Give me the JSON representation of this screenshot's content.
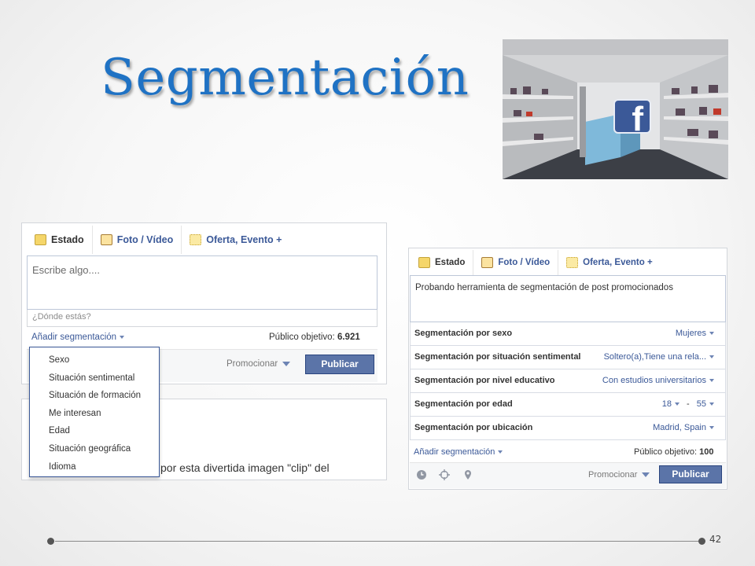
{
  "slide": {
    "title": "Segmentación",
    "page_number": "42"
  },
  "left_composer": {
    "tabs": [
      {
        "label": "Estado",
        "icon": "status-icon"
      },
      {
        "label": "Foto / Vídeo",
        "icon": "photo-icon"
      },
      {
        "label": "Oferta, Evento +",
        "icon": "offer-icon"
      }
    ],
    "placeholder": "Escribe algo....",
    "location_placeholder": "¿Dónde estás?",
    "add_segmentation": "Añadir segmentación",
    "audience_label": "Público objetivo:",
    "audience_value": "6.921",
    "promote": "Promocionar",
    "publish": "Publicar",
    "dropdown_items": [
      "Sexo",
      "Situación sentimental",
      "Situación de formación",
      "Me interesan",
      "Edad",
      "Situación geográfica",
      "Idioma"
    ],
    "background_post_text": "por esta divertida imagen \"clip\" del"
  },
  "right_composer": {
    "tabs": [
      {
        "label": "Estado",
        "icon": "status-icon"
      },
      {
        "label": "Foto / Vídeo",
        "icon": "photo-icon"
      },
      {
        "label": "Oferta, Evento +",
        "icon": "offer-icon"
      }
    ],
    "text": "Probando herramienta de segmentación de post promocionados",
    "rows": [
      {
        "label": "Segmentación por sexo",
        "value": "Mujeres"
      },
      {
        "label": "Segmentación por situación sentimental",
        "value": "Soltero(a),Tiene una rela..."
      },
      {
        "label": "Segmentación por nivel educativo",
        "value": "Con estudios universitarios"
      },
      {
        "label": "Segmentación por edad",
        "age_from": "18",
        "age_sep": "-",
        "age_to": "55"
      },
      {
        "label": "Segmentación por ubicación",
        "value": "Madrid, Spain"
      }
    ],
    "add_segmentation": "Añadir segmentación",
    "audience_label": "Público objetivo:",
    "audience_value": "100",
    "promote": "Promocionar",
    "publish": "Publicar"
  },
  "colors": {
    "title": "#1f72c4",
    "facebook_blue": "#3b5998",
    "publish_button": "#5b74a8"
  }
}
